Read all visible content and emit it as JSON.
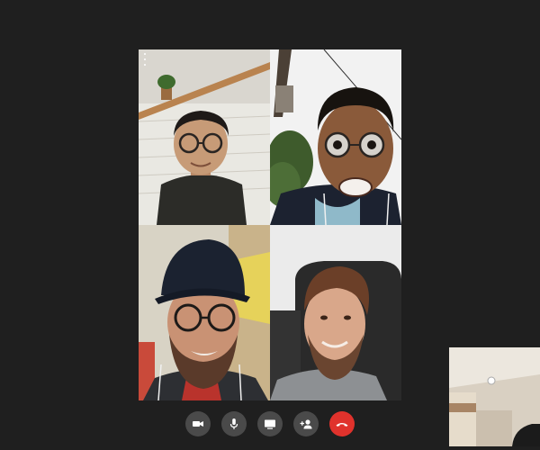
{
  "window": {
    "background": "#1f1f1f"
  },
  "participants": [
    {
      "id": "participant-1",
      "has_more_menu": true
    },
    {
      "id": "participant-2",
      "has_more_menu": false
    },
    {
      "id": "participant-3",
      "has_more_menu": false
    },
    {
      "id": "participant-4",
      "has_more_menu": false
    }
  ],
  "self_view": {
    "visible": true
  },
  "controls": [
    {
      "id": "camera",
      "icon": "video-camera-icon"
    },
    {
      "id": "microphone",
      "icon": "microphone-icon"
    },
    {
      "id": "screen_share",
      "icon": "screen-share-icon"
    },
    {
      "id": "add_participant",
      "icon": "add-person-icon"
    },
    {
      "id": "end_call",
      "icon": "hang-up-icon",
      "color": "#e0322c"
    }
  ],
  "colors": {
    "control_bg": "#4a4a4a",
    "end_call": "#e0322c"
  }
}
